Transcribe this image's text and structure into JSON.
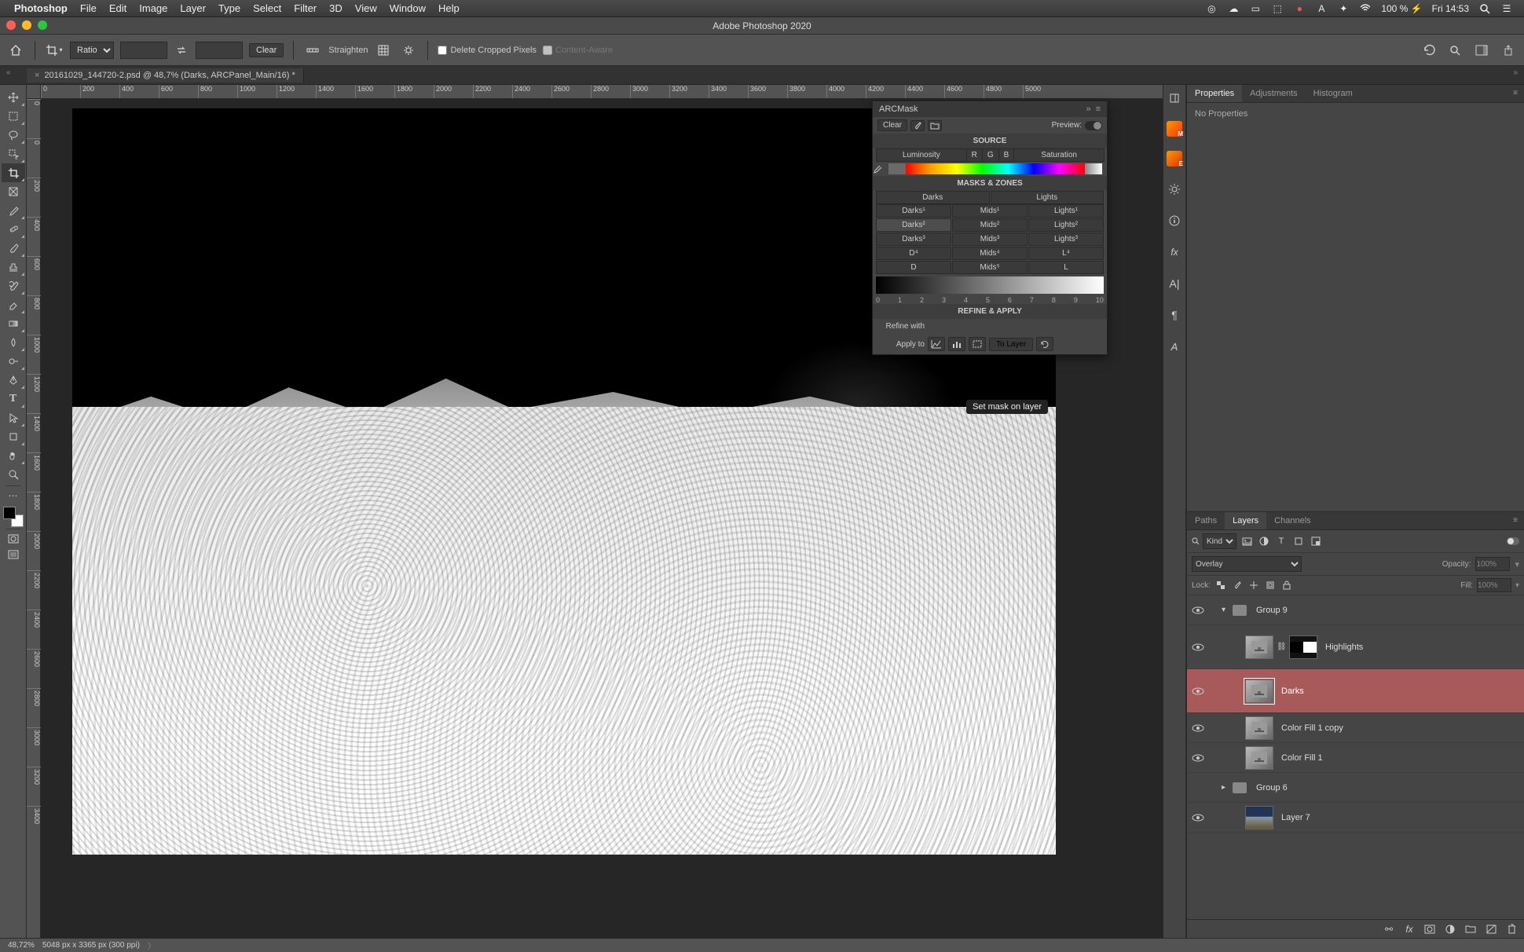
{
  "menubar": {
    "app": "Photoshop",
    "items": [
      "File",
      "Edit",
      "Image",
      "Layer",
      "Type",
      "Select",
      "Filter",
      "3D",
      "View",
      "Window",
      "Help"
    ],
    "battery": "100 % ⚡",
    "clock": "Fri 14:53"
  },
  "titlebar": {
    "title": "Adobe Photoshop 2020"
  },
  "options": {
    "ratio_label": "Ratio",
    "clear": "Clear",
    "straighten": "Straighten",
    "delete_cropped": "Delete Cropped Pixels",
    "content_aware": "Content-Aware"
  },
  "doc_tab": {
    "title": "20161029_144720-2.psd @ 48,7% (Darks, ARCPanel_Main/16) *"
  },
  "ruler_h": [
    "0",
    "200",
    "400",
    "600",
    "800",
    "1000",
    "1200",
    "1400",
    "1600",
    "1800",
    "2000",
    "2200",
    "2400",
    "2600",
    "2800",
    "3000",
    "3200",
    "3400",
    "3600",
    "3800",
    "4000",
    "4200",
    "4400",
    "4600",
    "4800",
    "5000"
  ],
  "ruler_v": [
    "0",
    "0",
    "200",
    "400",
    "600",
    "800",
    "1000",
    "1200",
    "1400",
    "1600",
    "1800",
    "2000",
    "2200",
    "2400",
    "2600",
    "2800",
    "3000",
    "3200",
    "3400"
  ],
  "arcmask": {
    "title": "ARCMask",
    "clear": "Clear",
    "preview": "Preview:",
    "source": "SOURCE",
    "src_tabs": {
      "lum": "Luminosity",
      "r": "R",
      "g": "G",
      "b": "B",
      "sat": "Saturation"
    },
    "masks_zones": "MASKS & ZONES",
    "darks": "Darks",
    "lights": "Lights",
    "rows": [
      {
        "d": "Darks¹",
        "m": "Mids¹",
        "l": "Lights¹"
      },
      {
        "d": "Darks²",
        "m": "Mids²",
        "l": "Lights²"
      },
      {
        "d": "Darks³",
        "m": "Mids³",
        "l": "Lights³"
      },
      {
        "d": "D⁴",
        "m": "Mids⁴",
        "l": "L⁴"
      },
      {
        "d": "D",
        "m": "Mids⁵",
        "l": "L"
      }
    ],
    "nums": [
      "0",
      "1",
      "2",
      "3",
      "4",
      "5",
      "6",
      "7",
      "8",
      "9",
      "10"
    ],
    "refine_apply": "REFINE & APPLY",
    "refine_with": "Refine with",
    "apply_to": "Apply to",
    "to_layer": "To Layer",
    "tooltip": "Set mask on layer"
  },
  "properties": {
    "tabs": [
      "Properties",
      "Adjustments",
      "Histogram"
    ],
    "no_props": "No Properties"
  },
  "layers_panel": {
    "tabs": [
      "Paths",
      "Layers",
      "Channels"
    ],
    "kind": "Kind",
    "blend": "Overlay",
    "opacity_lbl": "Opacity:",
    "opacity_val": "100%",
    "lock": "Lock:",
    "fill_lbl": "Fill:",
    "fill_val": "100%",
    "layers": [
      {
        "type": "group",
        "name": "Group 9",
        "open": true
      },
      {
        "type": "layer",
        "name": "Highlights",
        "thumb": "grad",
        "mask": true,
        "linked": true
      },
      {
        "type": "layer",
        "name": "Darks",
        "thumb": "grad",
        "selected": true,
        "big": true
      },
      {
        "type": "layer",
        "name": "Color Fill 1 copy",
        "thumb": "grad"
      },
      {
        "type": "layer",
        "name": "Color Fill 1",
        "thumb": "grad"
      },
      {
        "type": "group",
        "name": "Group 6",
        "open": false,
        "novis": true
      },
      {
        "type": "layer",
        "name": "Layer 7",
        "thumb": "img"
      }
    ]
  },
  "status": {
    "zoom": "48,72%",
    "dims": "5048 px x 3365 px (300 ppi)"
  }
}
